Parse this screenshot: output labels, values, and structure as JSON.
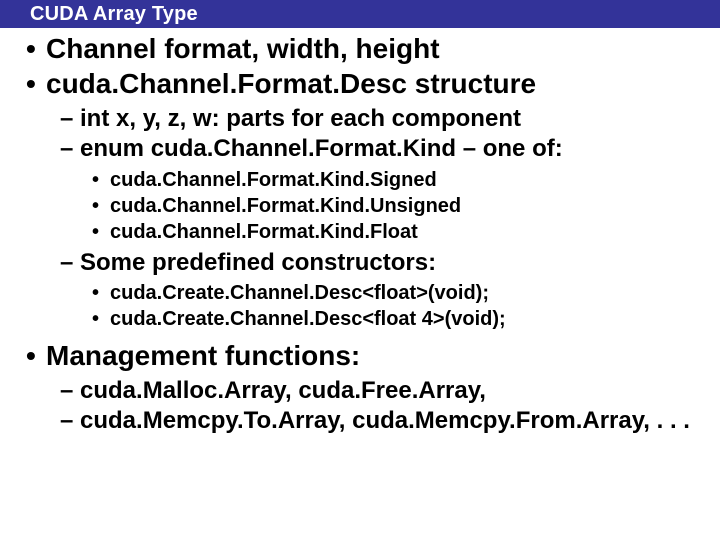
{
  "title": "CUDA Array Type",
  "bullets": {
    "l1a": "Channel format, width, height",
    "l1b": "cuda.Channel.Format.Desc structure",
    "l2a": "int x, y, z, w: parts for each component",
    "l2b": "enum cuda.Channel.Format.Kind – one of:",
    "l3a": "cuda.Channel.Format.Kind.Signed",
    "l3b": "cuda.Channel.Format.Kind.Unsigned",
    "l3c": "cuda.Channel.Format.Kind.Float",
    "l2c": "Some predefined constructors:",
    "l3d": "cuda.Create.Channel.Desc<float>(void);",
    "l3e": "cuda.Create.Channel.Desc<float 4>(void);",
    "l1c": "Management functions:",
    "l2d": "cuda.Malloc.Array, cuda.Free.Array,",
    "l2e": "cuda.Memcpy.To.Array, cuda.Memcpy.From.Array, . . ."
  }
}
